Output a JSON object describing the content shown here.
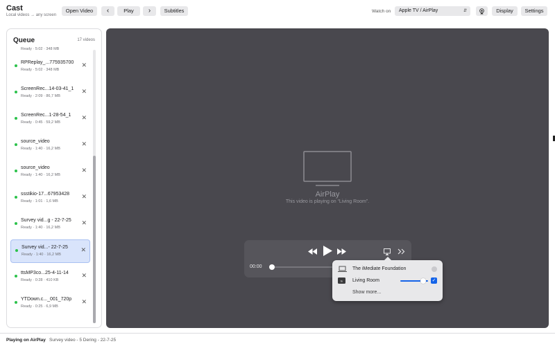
{
  "app": {
    "title": "Cast",
    "subtitle": "Local videos → any screen"
  },
  "toolbar": {
    "open_video": "Open Video",
    "prev": "‹",
    "play": "Play",
    "next": "›",
    "subtitles": "Subtitles",
    "watch_on_label": "Watch on",
    "watch_on_value": "Apple TV / AirPlay",
    "watch_on_chevron": "⌃⌄",
    "display": "Display",
    "settings": "Settings"
  },
  "queue": {
    "title": "Queue",
    "count": "17 videos",
    "partial_meta": "Ready · 5:02 · 348 MB",
    "items": [
      {
        "name": "RPReplay_...775935700",
        "meta": "Ready · 5:02 · 348 MB",
        "selected": false
      },
      {
        "name": "ScreenRec...14-03-41_1",
        "meta": "Ready · 2:09 · 86,7 MB",
        "selected": false
      },
      {
        "name": "ScreenRec...1-28-54_1",
        "meta": "Ready · 0:45 · 59,2 MB",
        "selected": false
      },
      {
        "name": "source_video",
        "meta": "Ready · 1:40 · 16,2 MB",
        "selected": false
      },
      {
        "name": "source_video",
        "meta": "Ready · 1:40 · 16,2 MB",
        "selected": false
      },
      {
        "name": "ssstikio-17...67953428",
        "meta": "Ready · 1:01 · 1,6 MB",
        "selected": false
      },
      {
        "name": "Survey vid...g - 22-7-25",
        "meta": "Ready · 1:40 · 16,2 MB",
        "selected": false
      },
      {
        "name": "Survey vid...- 22-7-25",
        "meta": "Ready · 1:40 · 16,2 MB",
        "selected": true
      },
      {
        "name": "ttsMP3co...25-4-11-14",
        "meta": "Ready · 0:28 · 410 KB",
        "selected": false
      },
      {
        "name": "YTDown.c..._001_720p",
        "meta": "Ready · 0:25 · 6,9 MB",
        "selected": false
      }
    ],
    "remove_glyph": "✕"
  },
  "player": {
    "airplay_title": "AirPlay",
    "airplay_subtitle": "This video is playing on “Living Room”.",
    "current_time": "00:00",
    "progress": 0.0
  },
  "airplay_menu": {
    "devices": [
      {
        "name": "The iMediate Foundation",
        "icon": "laptop-icon",
        "selected": false
      },
      {
        "name": "Living Room",
        "icon": "apple-tv-icon",
        "selected": true,
        "volume": 0.85
      }
    ],
    "show_more": "Show more...",
    "check_glyph": "✓"
  },
  "status": {
    "label": "Playing on AirPlay",
    "value": "Survey video - 5 Dering - 22-7-25"
  },
  "colors": {
    "accent": "#1463e8",
    "ready_dot": "#2cc24b",
    "video_bg": "#49484e",
    "selected_row": "#d9e4fb"
  }
}
